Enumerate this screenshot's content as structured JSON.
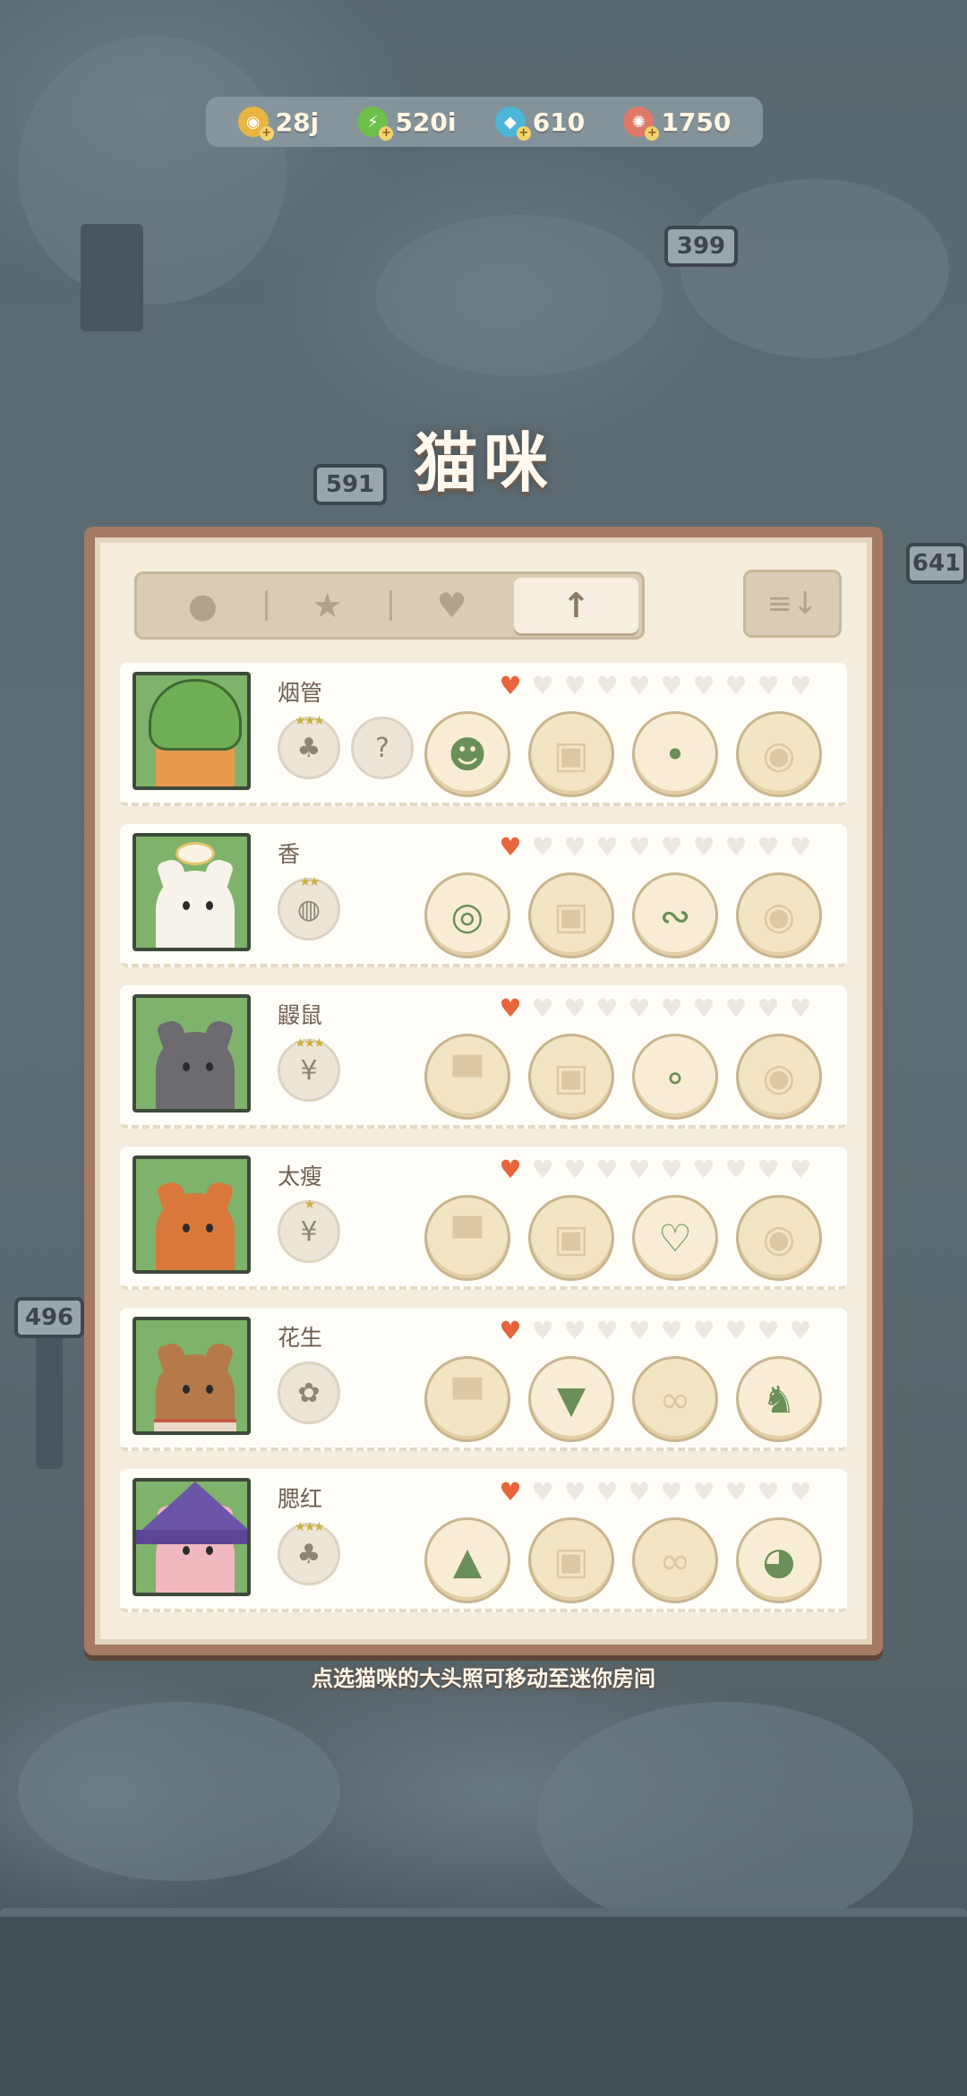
{
  "currencies": [
    {
      "name": "coin",
      "icon": "gold-coin-icon",
      "value": "28j",
      "color": "#e8b640"
    },
    {
      "name": "energy",
      "icon": "lightning-icon",
      "value": "520i",
      "color": "#6fc04a"
    },
    {
      "name": "gem",
      "icon": "diamond-icon",
      "value": "610",
      "color": "#4cb6d8"
    },
    {
      "name": "shell",
      "icon": "shell-icon",
      "value": "1750",
      "color": "#e07a68"
    }
  ],
  "title": "猫咪",
  "tabs": [
    {
      "icon": "cat-head-icon",
      "glyph": "●",
      "active": false
    },
    {
      "icon": "star-icon",
      "glyph": "★",
      "active": false
    },
    {
      "icon": "heart-icon",
      "glyph": "♥",
      "active": false
    },
    {
      "icon": "arrow-up-icon",
      "glyph": "↑",
      "active": true
    }
  ],
  "sort_icon": "sort-descending-icon",
  "sort_glyph": "≡↓",
  "cats": [
    {
      "name": "烟管",
      "hearts": 1,
      "max_hearts": 10,
      "badges": [
        {
          "icon": "broccoli-icon",
          "glyph": "♣",
          "stars": "★★★"
        },
        {
          "icon": "mystery-card-icon",
          "glyph": "?",
          "stars": ""
        }
      ],
      "slots": [
        {
          "icon": "frog-hat-icon",
          "glyph": "☻",
          "filled": true
        },
        {
          "icon": "shirt-slot-icon",
          "glyph": "▣",
          "filled": false
        },
        {
          "icon": "small-item-icon",
          "glyph": "•",
          "filled": true
        },
        {
          "icon": "pet-slot-icon",
          "glyph": "◉",
          "filled": false
        }
      ]
    },
    {
      "name": "香",
      "hearts": 1,
      "max_hearts": 10,
      "badges": [
        {
          "icon": "pumpkin-icon",
          "glyph": "◍",
          "stars": "★★"
        }
      ],
      "slots": [
        {
          "icon": "fried-egg-hat-icon",
          "glyph": "◎",
          "filled": true
        },
        {
          "icon": "shirt-slot-icon",
          "glyph": "▣",
          "filled": false
        },
        {
          "icon": "angel-wings-icon",
          "glyph": "∾",
          "filled": true
        },
        {
          "icon": "pet-slot-icon",
          "glyph": "◉",
          "filled": false
        }
      ]
    },
    {
      "name": "鼹鼠",
      "hearts": 1,
      "max_hearts": 10,
      "badges": [
        {
          "icon": "wheat-icon",
          "glyph": "¥",
          "stars": "★★★"
        }
      ],
      "slots": [
        {
          "icon": "hat-slot-icon",
          "glyph": "▀",
          "filled": false
        },
        {
          "icon": "shirt-slot-icon",
          "glyph": "▣",
          "filled": false
        },
        {
          "icon": "small-item-icon",
          "glyph": "∘",
          "filled": true
        },
        {
          "icon": "pet-slot-icon",
          "glyph": "◉",
          "filled": false
        }
      ]
    },
    {
      "name": "太瘦",
      "hearts": 1,
      "max_hearts": 10,
      "badges": [
        {
          "icon": "lavender-icon",
          "glyph": "¥",
          "stars": "★"
        }
      ],
      "slots": [
        {
          "icon": "hat-slot-icon",
          "glyph": "▀",
          "filled": false
        },
        {
          "icon": "shirt-slot-icon",
          "glyph": "▣",
          "filled": false
        },
        {
          "icon": "heart-glasses-icon",
          "glyph": "♡",
          "filled": true
        },
        {
          "icon": "pet-slot-icon",
          "glyph": "◉",
          "filled": false
        }
      ]
    },
    {
      "name": "花生",
      "hearts": 1,
      "max_hearts": 10,
      "badges": [
        {
          "icon": "lotus-root-icon",
          "glyph": "✿",
          "stars": ""
        }
      ],
      "slots": [
        {
          "icon": "hat-slot-icon",
          "glyph": "▀",
          "filled": false
        },
        {
          "icon": "sailor-collar-icon",
          "glyph": "▼",
          "filled": true
        },
        {
          "icon": "glasses-slot-icon",
          "glyph": "∞",
          "filled": false
        },
        {
          "icon": "dragon-pet-icon",
          "glyph": "♞",
          "filled": true
        }
      ]
    },
    {
      "name": "腮红",
      "hearts": 1,
      "max_hearts": 10,
      "badges": [
        {
          "icon": "herb-icon",
          "glyph": "♣",
          "stars": "★★★"
        }
      ],
      "slots": [
        {
          "icon": "witch-hat-icon",
          "glyph": "▲",
          "filled": true
        },
        {
          "icon": "shirt-slot-icon",
          "glyph": "▣",
          "filled": false
        },
        {
          "icon": "glasses-slot-icon",
          "glyph": "∞",
          "filled": false
        },
        {
          "icon": "husky-pet-icon",
          "glyph": "◕",
          "filled": true
        }
      ]
    }
  ],
  "hint": "点选猫咪的大头照可移动至迷你房间",
  "colors": {
    "panel_border": "#a47a64",
    "heart_on": "#e8643b",
    "portrait_bg": "#7fb26a"
  }
}
